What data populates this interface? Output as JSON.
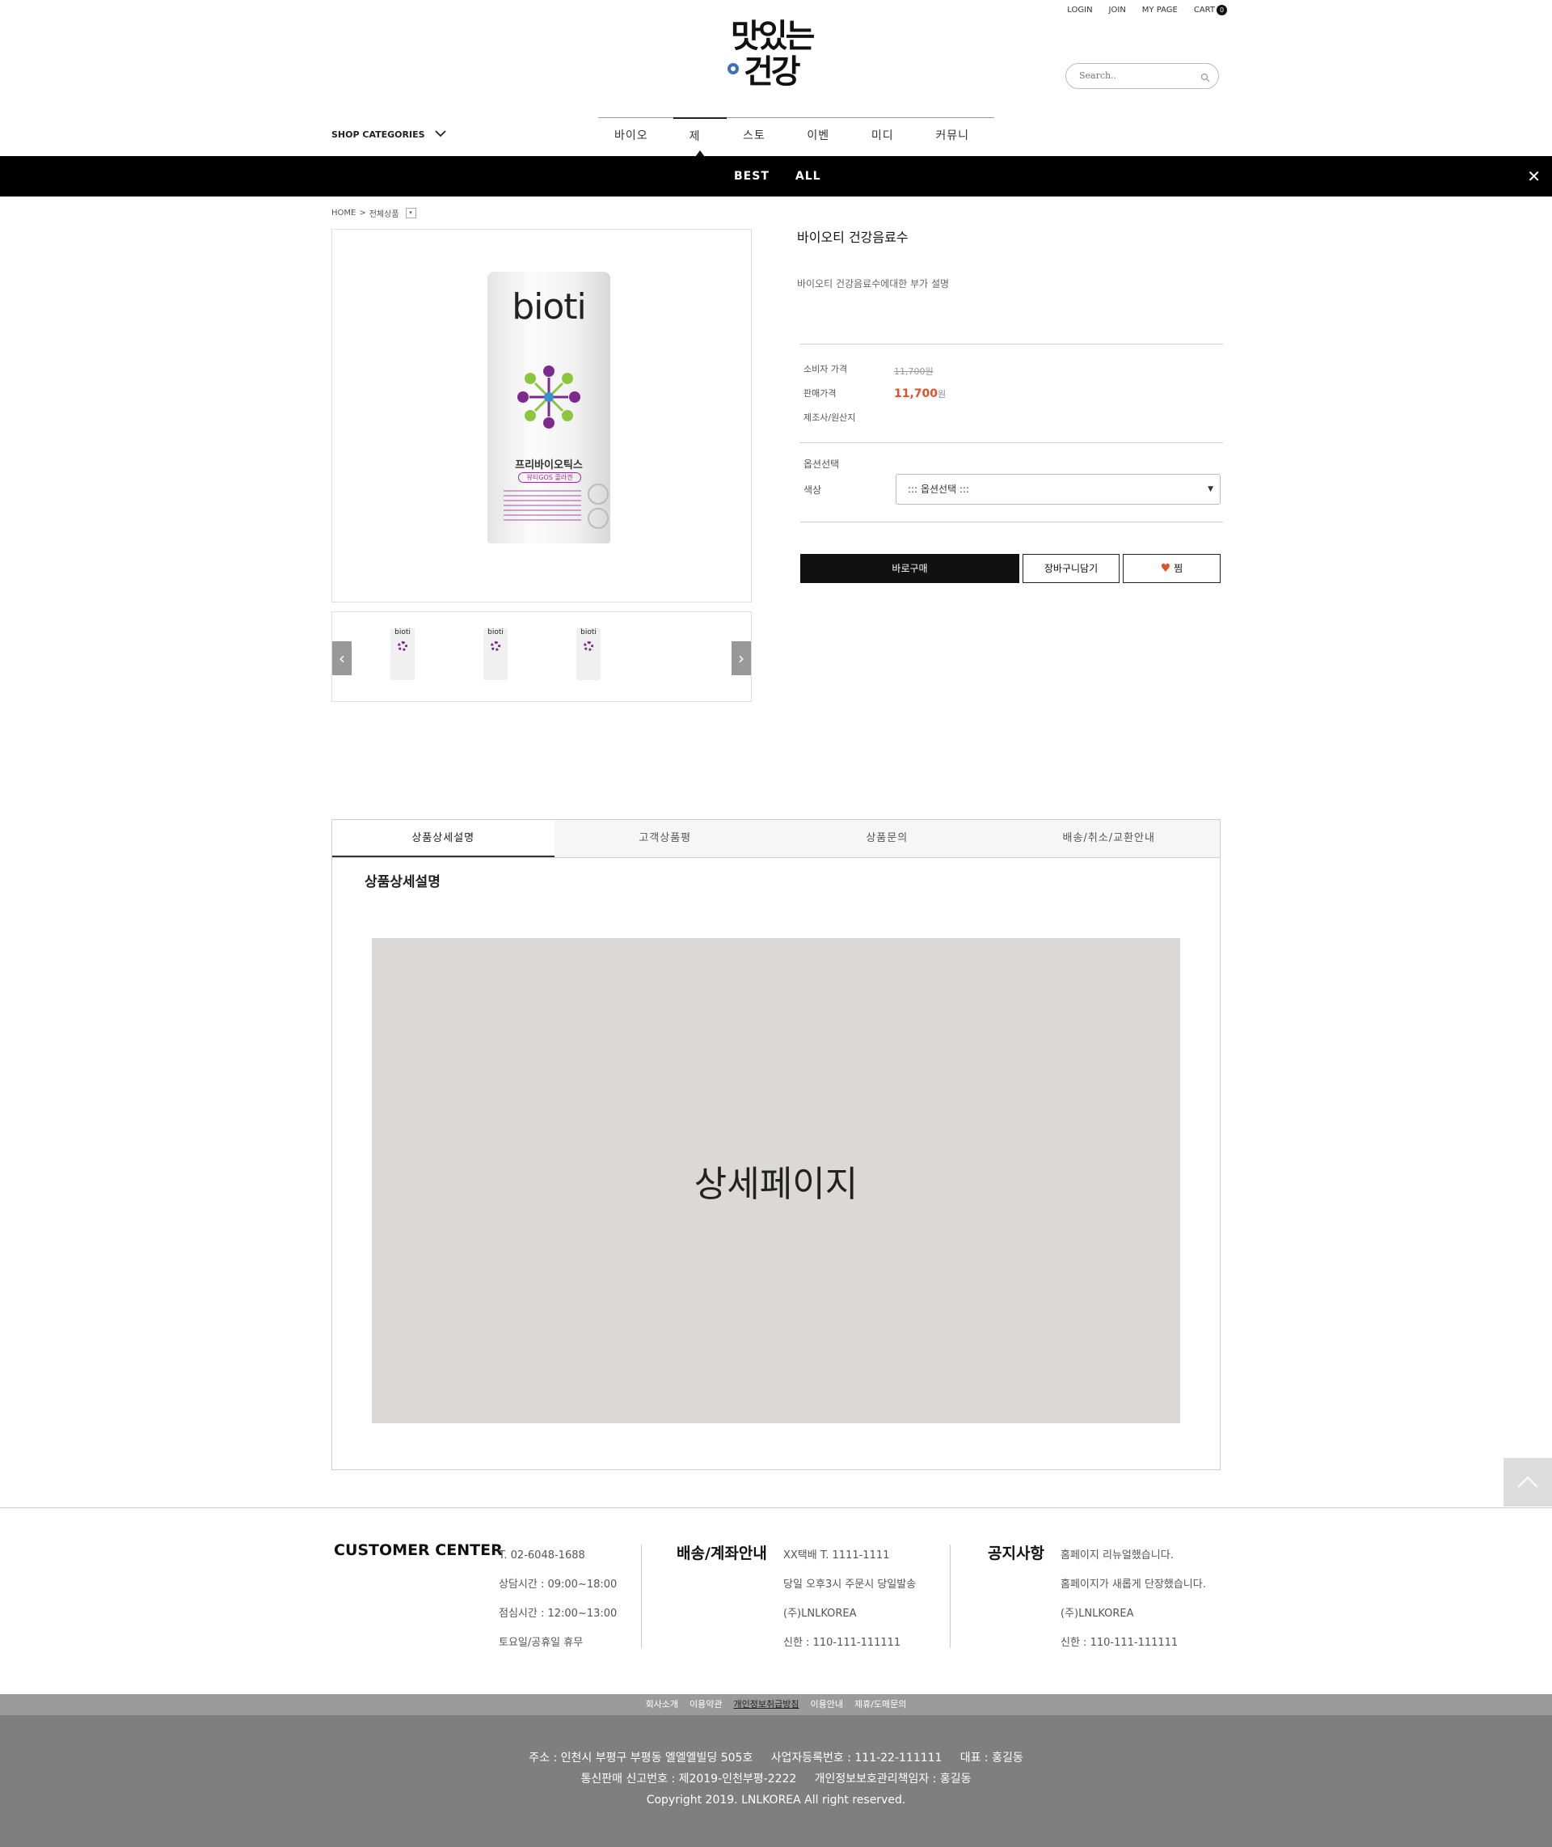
{
  "header": {
    "top_links": [
      "LOGIN",
      "JOIN",
      "MY PAGE",
      "CART"
    ],
    "cart_count": "0",
    "logo_line1": "맛있는",
    "logo_line2": "건강",
    "search_placeholder": "Search..",
    "shop_categories": "SHOP CATEGORIES",
    "nav": [
      "바이오티",
      "제품",
      "스토어",
      "이벤트",
      "미디어",
      "커뮤니티"
    ],
    "nav_active": "제품",
    "subnav": [
      "BEST",
      "ALL"
    ]
  },
  "breadcrumb": {
    "home": "HOME",
    "sep": ">",
    "current": "전체상품"
  },
  "product": {
    "image_brand": "bioti",
    "image_line1": "프리바이오틱스",
    "image_line2": "뷰티GOS 콜라겐",
    "name": "바이오티 건강음료수",
    "description": "바이오티 건강음료수에대한 부가 설명",
    "consumer_price_label": "소비자 가격",
    "consumer_price": "11,700",
    "sale_price_label": "판매가격",
    "sale_price": "11,700",
    "won": "원",
    "maker_label": "제조사/원산지",
    "option_title": "옵션선택",
    "color_label": "색상",
    "option_select": "::: 옵션선택 :::",
    "buy_button": "바로구매",
    "cart_button": "장바구니담기",
    "wish_button": "찜",
    "accent_color": "#e0502b"
  },
  "detail": {
    "tabs": [
      "상품상세설명",
      "고객상품평",
      "상품문의",
      "배송/취소/교환안내"
    ],
    "title": "상품상세설명",
    "placeholder": "상세페이지"
  },
  "footer": {
    "cc_title": "CUSTOMER CENTER",
    "cc_lines": [
      "T. 02-6048-1688",
      "상담시간 : 09:00~18:00",
      "점심시간 : 12:00~13:00",
      "토요일/공휴일 휴무"
    ],
    "ship_title": "배송/계좌안내",
    "ship_lines": [
      "XX택배 T. 1111-1111",
      "당일 오후3시 주문시 당일발송",
      "(주)LNLKOREA",
      "신한 : 110-111-111111"
    ],
    "notice_title": "공지사항",
    "notice_lines": [
      "홈페이지 리뉴얼했습니다.",
      "홈페이지가 새롭게 단장했습니다.",
      "(주)LNLKOREA",
      "신한 : 110-111-111111"
    ],
    "links": [
      "회사소개",
      "이용약관",
      "개인정보취급방침",
      "이용안내",
      "제휴/도매문의"
    ],
    "address_line": "주소 : 인천시 부평구 부평동 엘엘엘빌딩 505호     사업자등록번호 : 111-22-111111     대표 : 홍길동",
    "license_line": "통신판매 신고번호 : 제2019-인천부평-2222     개인정보보호관리책임자 : 홍길동",
    "copyright": "Copyright 2019. LNLKOREA All right reserved."
  }
}
